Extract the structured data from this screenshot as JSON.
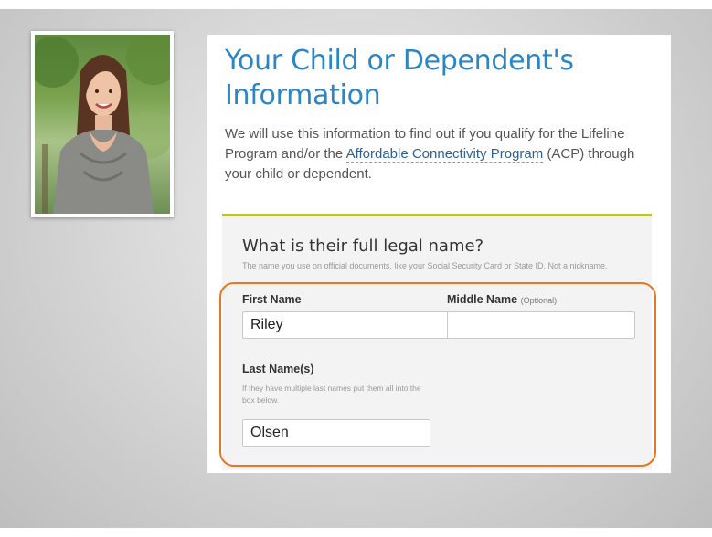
{
  "form": {
    "title": "Your Child or Dependent's Information",
    "intro_before_link": "We will use this information to find out if you qualify for the Lifeline Program and/or the ",
    "intro_link": "Affordable Connectivity Program",
    "intro_after_link": " (ACP) through your child or dependent.",
    "question": "What is their full legal name?",
    "question_help": "The name you use on official documents, like your Social Security Card or State ID. Not a nickname.",
    "first_name": {
      "label": "First Name",
      "value": "Riley"
    },
    "middle_name": {
      "label": "Middle Name",
      "optional": "(Optional)",
      "value": ""
    },
    "last_name": {
      "label": "Last Name(s)",
      "help": "If they have multiple last names put them all into the box below.",
      "value": "Olsen"
    }
  },
  "colors": {
    "title": "#2b86c5",
    "link": "#2f5f8f",
    "card_top_border": "#b8c23a",
    "highlight": "#e87722"
  }
}
